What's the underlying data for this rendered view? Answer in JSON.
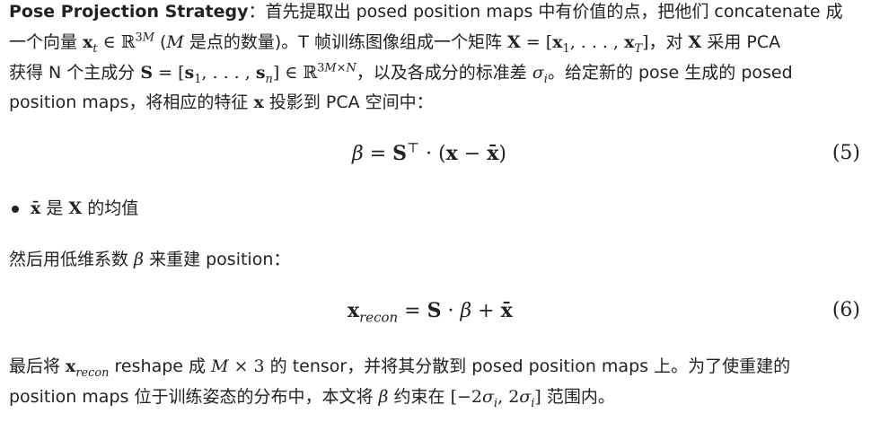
{
  "heading": {
    "label": "Pose Projection Strategy",
    "colon": "："
  },
  "para1": {
    "l1_a": "首先提取出 posed position maps 中有价值的点，把他们 concatenate 成",
    "l2_a": "一个向量 ",
    "l2_b": " (",
    "l2_c": " 是点的数量)。T 帧训练图像组成一个矩阵 ",
    "l2_d": "，对 ",
    "l2_e": " 采用 PCA",
    "l3_a": "获得 N 个主成分 ",
    "l3_b": "，以及各成分的标准差 ",
    "l3_c": "。给定新的 pose 生成的 posed",
    "l4_a": "position maps，将相应的特征 ",
    "l4_b": " 投影到 PCA 空间中："
  },
  "equation5": {
    "number": "(5)"
  },
  "bullet": {
    "text_a": " 是 ",
    "text_b": " 的均值"
  },
  "para2": {
    "text_a": "然后用低维系数 ",
    "text_b": " 来重建 position："
  },
  "equation6": {
    "number": "(6)"
  },
  "para3": {
    "l1_a": "最后将 ",
    "l1_b": " reshape 成 ",
    "l1_c": " 的 tensor，并将其分散到 posed position maps 上。为了使重建的",
    "l2_a": "position maps 位于训练姿态的分布中，本文将 ",
    "l2_b": " 约束在 ",
    "l2_c": " 范围内。"
  }
}
